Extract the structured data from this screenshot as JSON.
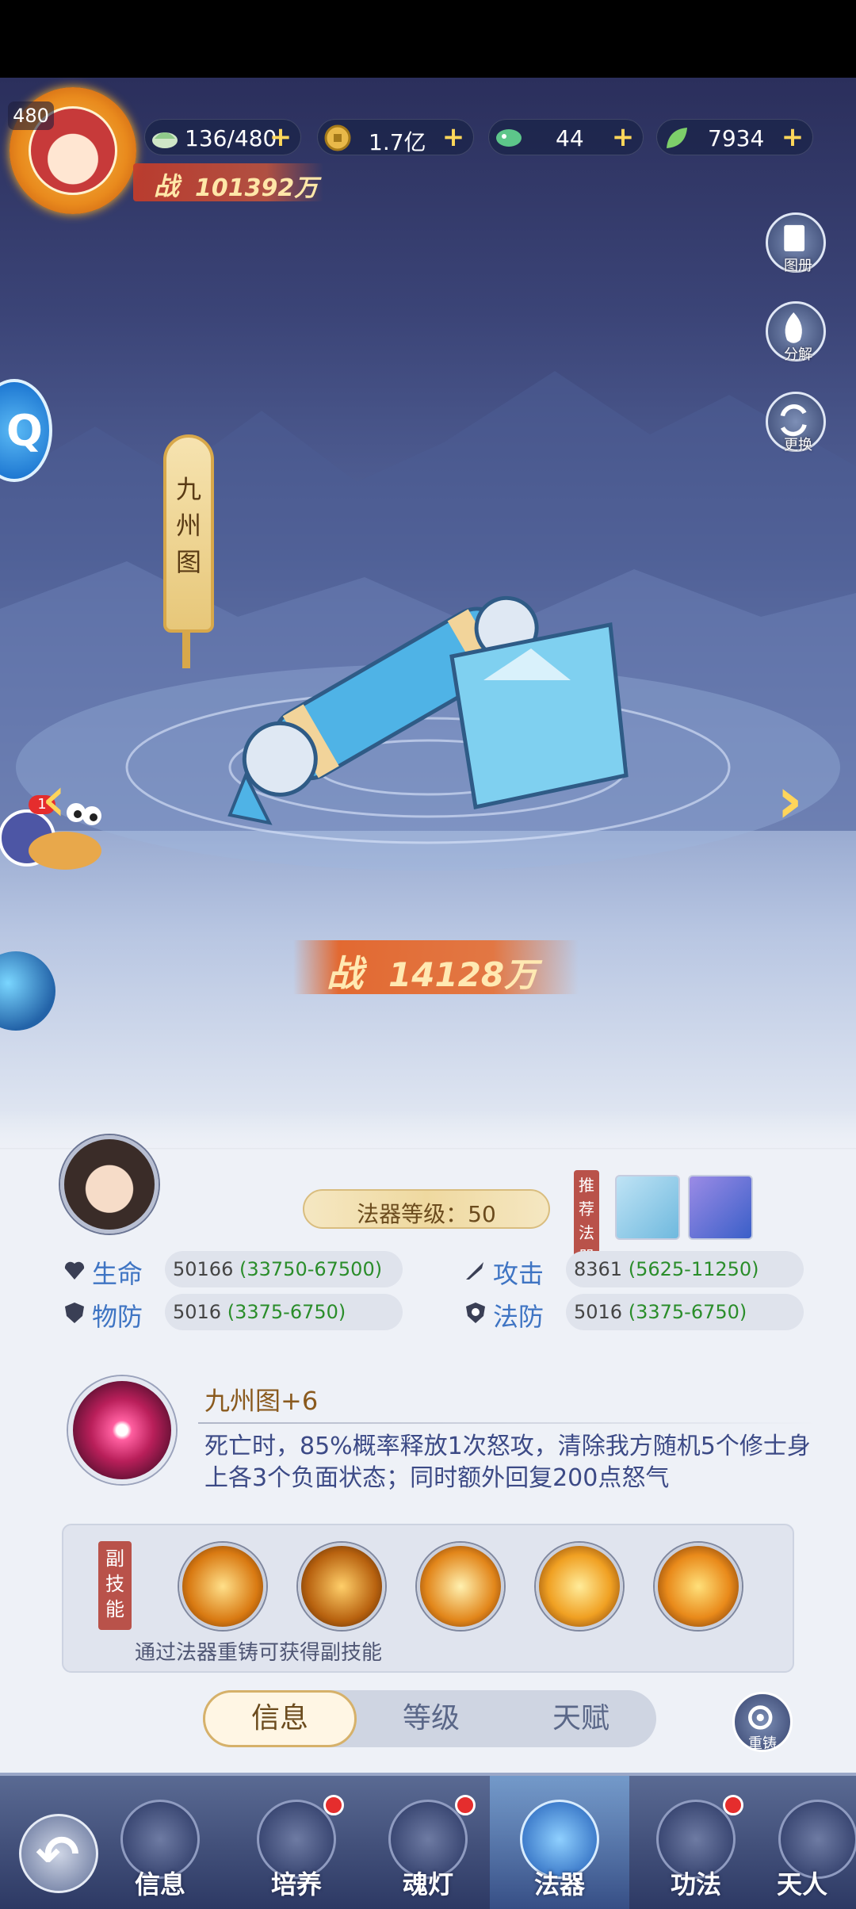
{
  "header": {
    "avatar_level": "480",
    "power_label": "战",
    "power_value": "101392万",
    "resources": [
      {
        "icon": "stamina-icon",
        "value": "136/480"
      },
      {
        "icon": "coin-icon",
        "value": "1.7亿"
      },
      {
        "icon": "jade-icon",
        "value": "44"
      },
      {
        "icon": "leaf-icon",
        "value": "7934"
      }
    ],
    "plus": "+"
  },
  "side_buttons": {
    "atlas": "图册",
    "decompose": "分解",
    "replace": "更换"
  },
  "artifact": {
    "name": "九州图",
    "power_label": "战",
    "power_value": "14128万"
  },
  "snail_badge": "1",
  "panel": {
    "level_text": "法器等级：50",
    "recommend_tag": "推荐法器",
    "stats": [
      {
        "label": "生命",
        "value": "50166",
        "range": "(33750-67500)",
        "icon": "heart-icon"
      },
      {
        "label": "攻击",
        "value": "8361",
        "range": "(5625-11250)",
        "icon": "sword-icon"
      },
      {
        "label": "物防",
        "value": "5016",
        "range": "(3375-6750)",
        "icon": "shield-icon"
      },
      {
        "label": "法防",
        "value": "5016",
        "range": "(3375-6750)",
        "icon": "magic-shield-icon"
      }
    ],
    "skill_name": "九州图+6",
    "skill_desc": "死亡时，85%概率释放1次怒攻，清除我方随机5个修士身上各3个负面状态；同时额外回复200点怒气",
    "sub_skill_tag": "副技能",
    "sub_skill_hint": "通过法器重铸可获得副技能",
    "tabs": [
      "信息",
      "等级",
      "天赋"
    ],
    "recast": "重铸"
  },
  "bottom_nav": [
    "信息",
    "培养",
    "魂灯",
    "法器",
    "功法",
    "天人"
  ],
  "colors": {
    "accent_gold": "#d6b16a",
    "stat_blue": "#3e74c3",
    "range_green": "#2a8d2a",
    "badge_red": "#e52d2d"
  }
}
